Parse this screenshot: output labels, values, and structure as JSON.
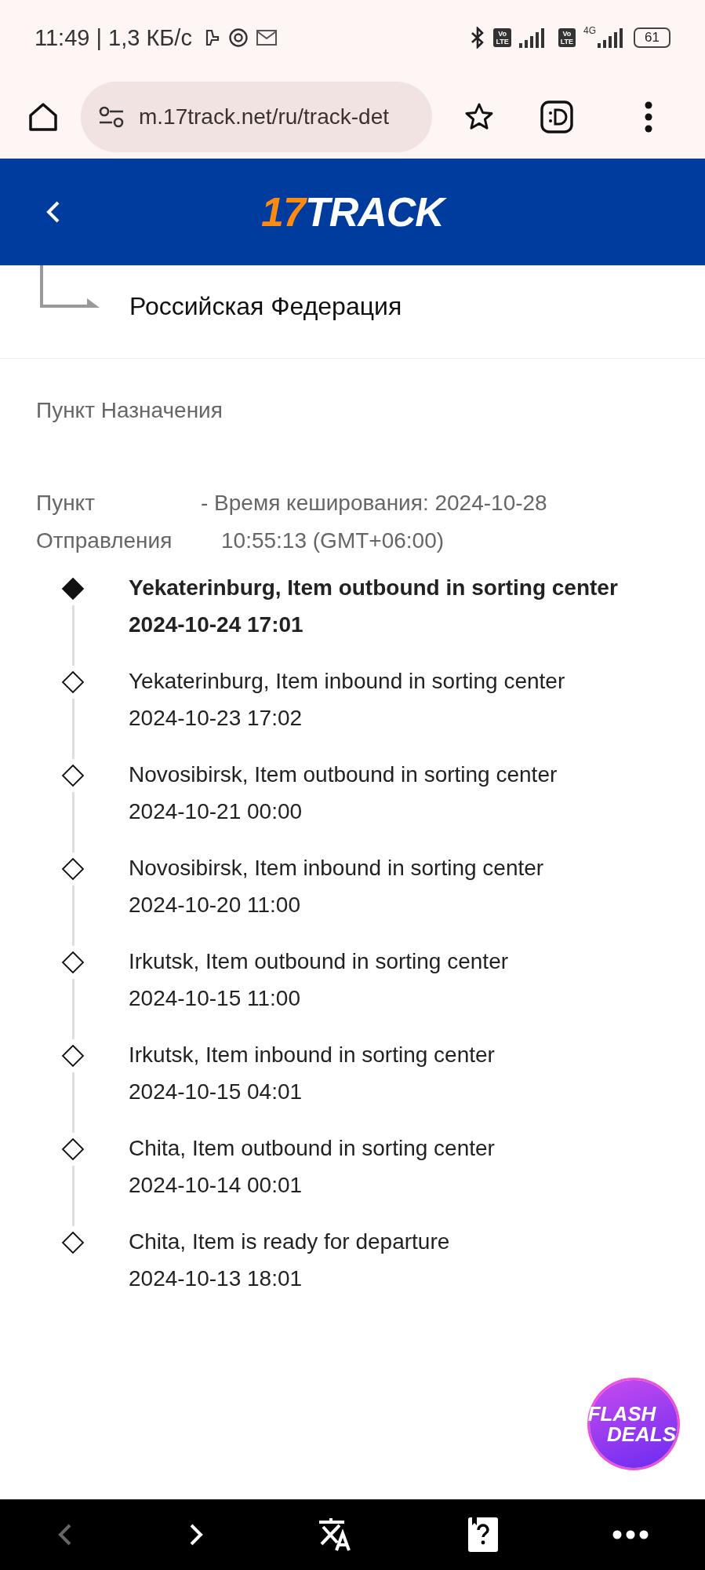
{
  "status_bar": {
    "time_speed": "11:49 | 1,3 КБ/с",
    "sim1": {
      "top": "Vo",
      "bottom": "LTE"
    },
    "sim2": {
      "top": "Vo",
      "bottom": "LTE"
    },
    "network": "4G",
    "battery": "61"
  },
  "browser": {
    "url": "m.17track.net/ru/track-det"
  },
  "header": {
    "logo_number": "17",
    "logo_word": "TRACK"
  },
  "route": {
    "country": "Российская Федерация"
  },
  "destination_label": "Пункт Назначения",
  "origin": {
    "label": "Пункт Отправления",
    "cache_note": "- Время кеширования: 2024-10-28",
    "cache_time": "10:55:13 (GMT+06:00)"
  },
  "events": [
    {
      "text": "Yekaterinburg, Item outbound in sorting center",
      "time": "2024-10-24 17:01",
      "latest": true
    },
    {
      "text": "Yekaterinburg, Item inbound in sorting center",
      "time": "2024-10-23 17:02",
      "latest": false
    },
    {
      "text": "Novosibirsk, Item outbound in sorting center",
      "time": "2024-10-21 00:00",
      "latest": false
    },
    {
      "text": "Novosibirsk, Item inbound in sorting center",
      "time": "2024-10-20 11:00",
      "latest": false
    },
    {
      "text": "Irkutsk, Item outbound in sorting center",
      "time": "2024-10-15 11:00",
      "latest": false
    },
    {
      "text": "Irkutsk, Item inbound in sorting center",
      "time": "2024-10-15 04:01",
      "latest": false
    },
    {
      "text": "Chita, Item outbound in sorting center",
      "time": "2024-10-14 00:01",
      "latest": false
    },
    {
      "text": "Chita, Item is ready for departure",
      "time": "2024-10-13 18:01",
      "latest": false
    }
  ],
  "promo": {
    "line1": "FLASH",
    "line2": "DEALS"
  },
  "bottom_nav": {
    "back_disabled": true,
    "forward_disabled": false
  }
}
